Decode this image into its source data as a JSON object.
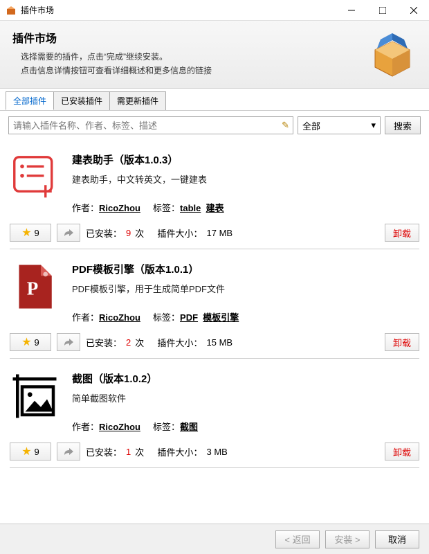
{
  "window": {
    "title": "插件市场"
  },
  "header": {
    "title": "插件市场",
    "sub1": "选择需要的插件，点击“完成”继续安装。",
    "sub2": "点击信息详情按钮可查看详细概述和更多信息的链接"
  },
  "tabs": [
    "全部插件",
    "已安装插件",
    "需更新插件"
  ],
  "active_tab": 0,
  "search": {
    "placeholder": "请输入插件名称、作者、标签、描述",
    "filter": "全部",
    "button": "搜索"
  },
  "labels": {
    "author": "作者：",
    "tag": "标签：",
    "installed": "已安装：",
    "times": "次",
    "size": "插件大小：",
    "uninstall": "卸载",
    "version_prefix": "（版本",
    "version_suffix": "）"
  },
  "plugins": [
    {
      "name": "建表助手",
      "version": "1.0.3",
      "desc": "建表助手，中文转英文，一键建表",
      "author": "RicoZhou",
      "tags": [
        "table",
        "建表"
      ],
      "stars": 9,
      "installs": 9,
      "size": "17 MB",
      "icon": "list"
    },
    {
      "name": "PDF模板引擎",
      "version": "1.0.1",
      "desc": "PDF模板引擎，用于生成简单PDF文件",
      "author": "RicoZhou",
      "tags": [
        "PDF",
        "模板引擎"
      ],
      "stars": 9,
      "installs": 2,
      "size": "15 MB",
      "icon": "pdf"
    },
    {
      "name": "截图",
      "version": "1.0.2",
      "desc": "简单截图软件",
      "author": "RicoZhou",
      "tags": [
        "截图"
      ],
      "stars": 9,
      "installs": 1,
      "size": "3 MB",
      "icon": "screenshot"
    }
  ],
  "footer": {
    "back": "< 返回",
    "install": "安装 >",
    "cancel": "取消"
  }
}
